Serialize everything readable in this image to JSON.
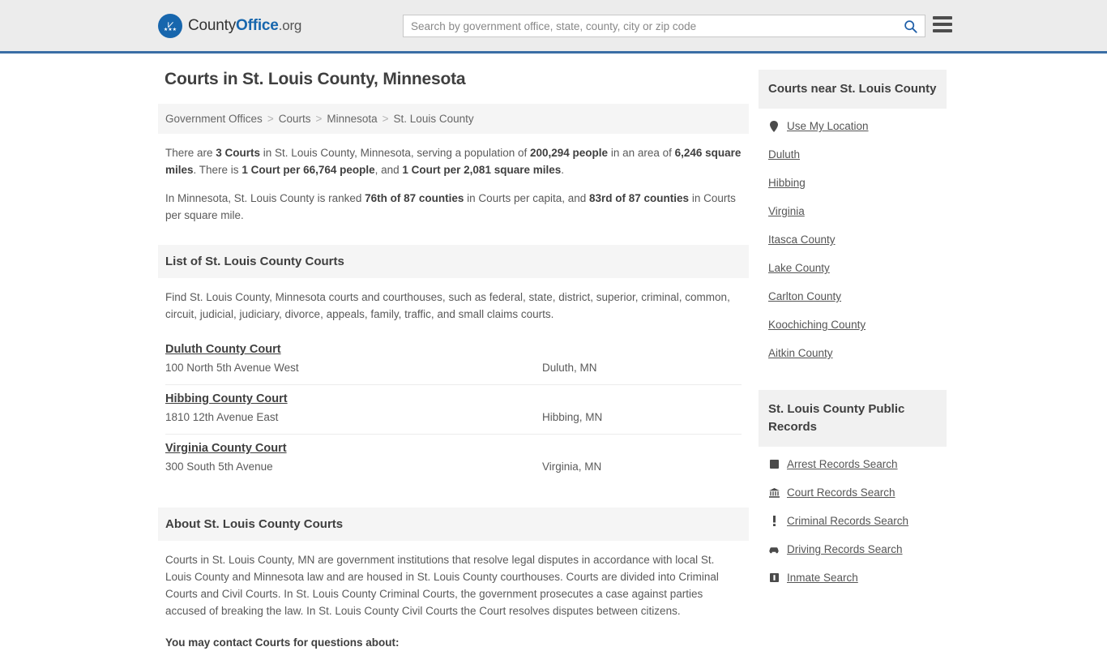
{
  "header": {
    "logo": {
      "part1": "County",
      "part2": "Office",
      "part3": ".org",
      "icon": "eagle-badge-icon",
      "stars": "★★★",
      "wings": "⩗"
    },
    "search": {
      "placeholder": "Search by government office, state, county, city or zip code",
      "value": "",
      "icon": "search-icon"
    },
    "menu_icon": "hamburger-menu-icon"
  },
  "page": {
    "title": "Courts in St. Louis County, Minnesota"
  },
  "breadcrumb": {
    "items": [
      {
        "label": "Government Offices"
      },
      {
        "label": "Courts"
      },
      {
        "label": "Minnesota"
      },
      {
        "label": "St. Louis County"
      }
    ],
    "separator": ">"
  },
  "stats": {
    "p1": {
      "t1": "There are ",
      "b1": "3 Courts",
      "t2": " in St. Louis County, Minnesota, serving a population of ",
      "b2": "200,294 people",
      "t3": " in an area of ",
      "b3": "6,246 square miles",
      "t4": ". There is ",
      "b4": "1 Court per 66,764 people",
      "t5": ", and ",
      "b5": "1 Court per 2,081 square miles",
      "t6": "."
    },
    "p2": {
      "t1": "In Minnesota, St. Louis County is ranked ",
      "b1": "76th of 87 counties",
      "t2": " in Courts per capita, and ",
      "b2": "83rd of 87 counties",
      "t3": " in Courts per square mile."
    }
  },
  "list_section": {
    "heading": "List of St. Louis County Courts",
    "description": "Find St. Louis County, Minnesota courts and courthouses, such as federal, state, district, superior, criminal, common, circuit, judicial, judiciary, divorce, appeals, family, traffic, and small claims courts.",
    "courts": [
      {
        "name": "Duluth County Court",
        "address": "100 North 5th Avenue West",
        "city": "Duluth, MN"
      },
      {
        "name": "Hibbing County Court",
        "address": "1810 12th Avenue East",
        "city": "Hibbing, MN"
      },
      {
        "name": "Virginia County Court",
        "address": "300 South 5th Avenue",
        "city": "Virginia, MN"
      }
    ]
  },
  "about_section": {
    "heading": "About St. Louis County Courts",
    "paragraph": "Courts in St. Louis County, MN are government institutions that resolve legal disputes in accordance with local St. Louis County and Minnesota law and are housed in St. Louis County courthouses. Courts are divided into Criminal Courts and Civil Courts. In St. Louis County Criminal Courts, the government prosecutes a case against parties accused of breaking the law. In St. Louis County Civil Courts the Court resolves disputes between citizens.",
    "contact_heading": "You may contact Courts for questions about:"
  },
  "sidebar": {
    "nearby": {
      "heading": "Courts near St. Louis County",
      "items": [
        {
          "label": "Use My Location",
          "icon": "map-pin-icon",
          "glyph": "•"
        },
        {
          "label": "Duluth",
          "icon": "",
          "glyph": ""
        },
        {
          "label": "Hibbing",
          "icon": "",
          "glyph": ""
        },
        {
          "label": "Virginia",
          "icon": "",
          "glyph": ""
        },
        {
          "label": "Itasca County",
          "icon": "",
          "glyph": ""
        },
        {
          "label": "Lake County",
          "icon": "",
          "glyph": ""
        },
        {
          "label": "Carlton County",
          "icon": "",
          "glyph": ""
        },
        {
          "label": "Koochiching County",
          "icon": "",
          "glyph": ""
        },
        {
          "label": "Aitkin County",
          "icon": "",
          "glyph": ""
        }
      ]
    },
    "records": {
      "heading": "St. Louis County Public Records",
      "items": [
        {
          "label": "Arrest Records Search",
          "icon": "fingerprint-square-icon",
          "glyph": "■"
        },
        {
          "label": "Court Records Search",
          "icon": "courthouse-icon",
          "glyph": "🏛"
        },
        {
          "label": "Criminal Records Search",
          "icon": "exclamation-icon",
          "glyph": "!"
        },
        {
          "label": "Driving Records Search",
          "icon": "car-icon",
          "glyph": "🚗"
        },
        {
          "label": "Inmate Search",
          "icon": "inmate-icon",
          "glyph": "▣"
        }
      ]
    }
  },
  "colors": {
    "accent_blue": "#1766ad",
    "header_bg": "#ececec",
    "header_border": "#3a6ea5",
    "section_bg": "#f5f5f5",
    "text": "#4a4a4a"
  }
}
